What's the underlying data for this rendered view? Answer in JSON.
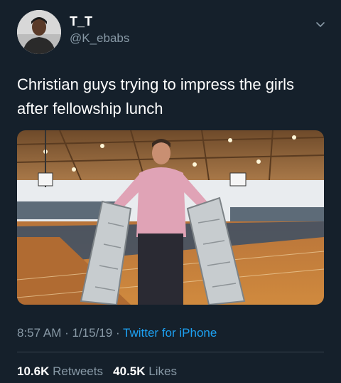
{
  "author": {
    "display_name": "T_T",
    "handle": "@K_ebabs"
  },
  "tweet": {
    "text_line1": "Christian guys trying to impress the girls",
    "text_line2": "after fellowship lunch"
  },
  "meta": {
    "time": "8:57 AM",
    "date": "1/15/19",
    "separator": " · ",
    "source": "Twitter for iPhone"
  },
  "stats": {
    "retweets_count": "10.6K",
    "retweets_label": "Retweets",
    "likes_count": "40.5K",
    "likes_label": "Likes"
  },
  "icons": {
    "menu": "chevron-down-icon"
  },
  "colors": {
    "background": "#15202b",
    "text_primary": "#ffffff",
    "text_secondary": "#8899a6",
    "link": "#1da1f2",
    "divider": "#38444d"
  }
}
